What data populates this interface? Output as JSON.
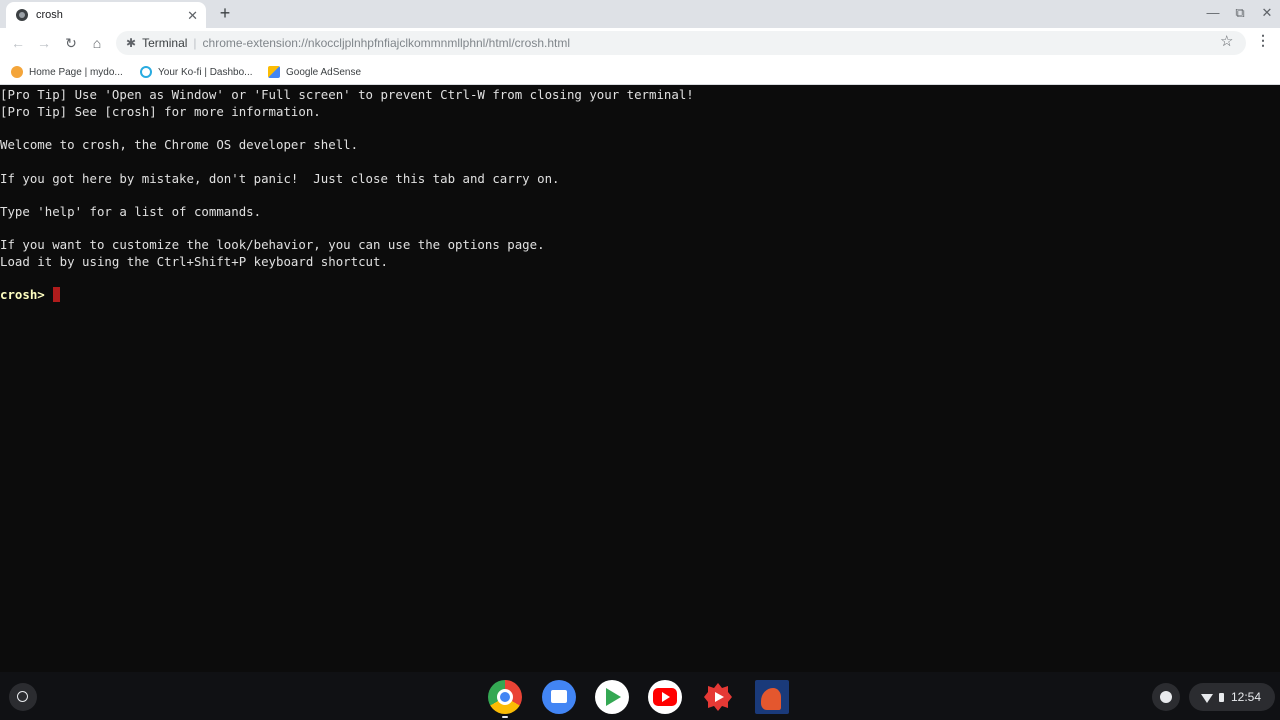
{
  "browser": {
    "tab": {
      "title": "crosh",
      "close": "✕"
    },
    "new_tab": "+",
    "window_controls": {
      "minimize": "—",
      "restore": "⧉",
      "close": "✕"
    },
    "nav": {
      "back": "←",
      "forward": "→",
      "reload": "↻",
      "home": "⌂"
    },
    "omnibox": {
      "site_name": "Terminal",
      "separator": "|",
      "url": "chrome-extension://nkoccljplnhpfnfiajclkommnmllphnl/html/crosh.html"
    },
    "star": "☆",
    "menu": "⋮",
    "bookmarks": [
      {
        "label": "Home Page | mydo...",
        "icon": "mydomain-icon"
      },
      {
        "label": "Your Ko-fi | Dashbo...",
        "icon": "kofi-icon"
      },
      {
        "label": "Google AdSense",
        "icon": "adsense-icon"
      }
    ]
  },
  "terminal": {
    "lines": [
      "[Pro Tip] Use 'Open as Window' or 'Full screen' to prevent Ctrl-W from closing your terminal!",
      "[Pro Tip] See [crosh] for more information.",
      "Welcome to crosh, the Chrome OS developer shell.",
      "If you got here by mistake, don't panic!  Just close this tab and carry on.",
      "Type 'help' for a list of commands.",
      "If you want to customize the look/behavior, you can use the options page.",
      "Load it by using the Ctrl+Shift+P keyboard shortcut."
    ],
    "prompt": "crosh> ",
    "colors": {
      "background": "#0c0c0c",
      "text": "#e0e0e0",
      "prompt": "#ffffc0",
      "cursor": "#b01c1c"
    }
  },
  "shelf": {
    "apps": [
      "chrome-icon",
      "files-icon",
      "play-store-icon",
      "youtube-icon",
      "gear-app-icon",
      "crosh-app-icon"
    ],
    "clock": "12:54"
  }
}
